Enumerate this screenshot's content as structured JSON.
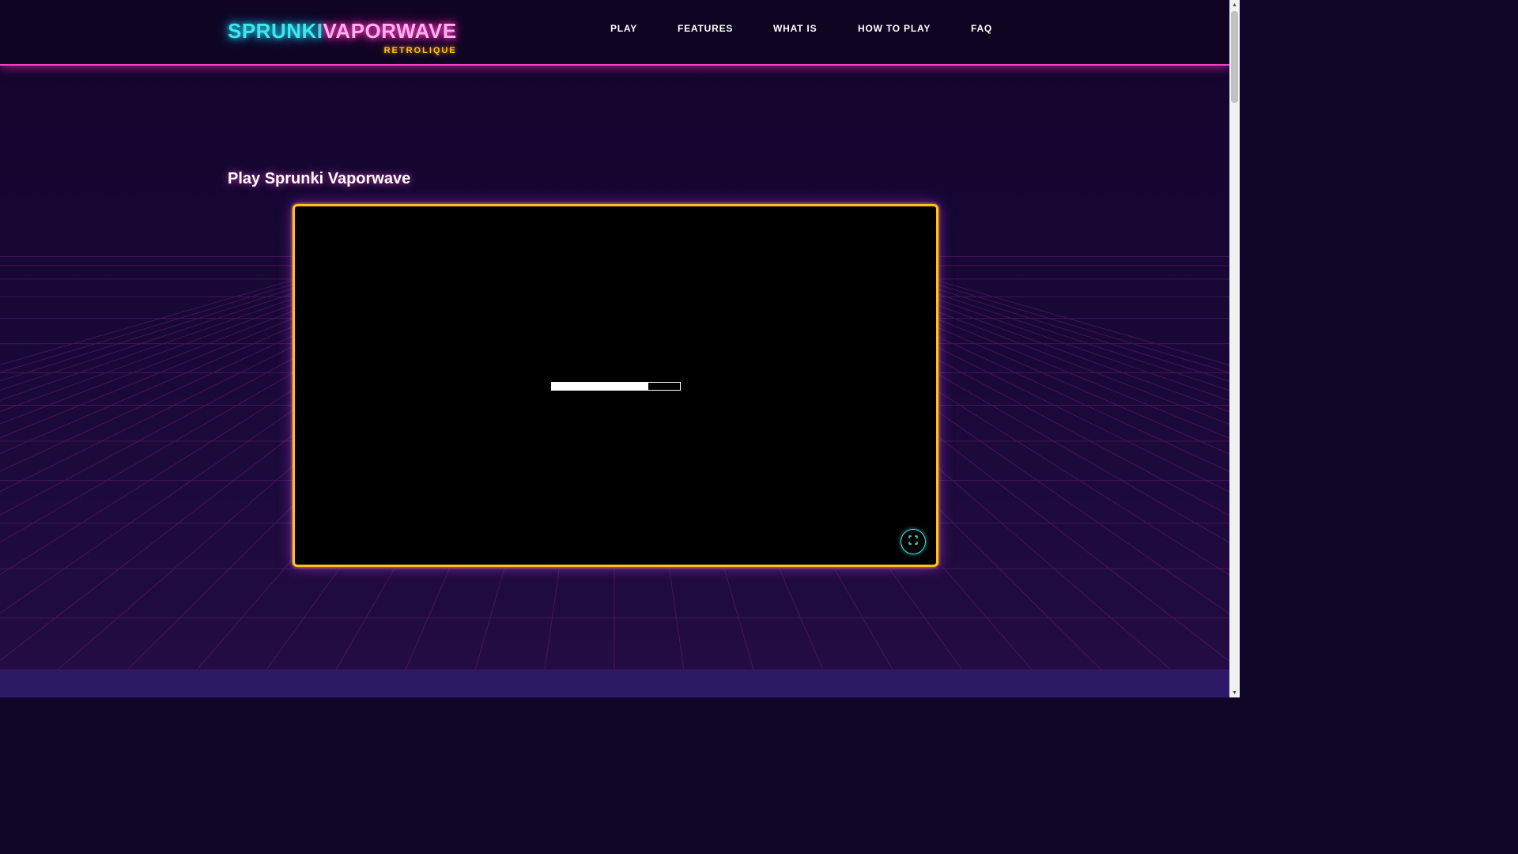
{
  "header": {
    "logo_part1": "SPRUNKI",
    "logo_part2": "VAPORWAVE",
    "logo_tagline": "RETROLIQUE",
    "nav": [
      {
        "label": "PLAY"
      },
      {
        "label": "FEATURES"
      },
      {
        "label": "WHAT IS"
      },
      {
        "label": "HOW TO PLAY"
      },
      {
        "label": "FAQ"
      }
    ]
  },
  "main": {
    "section_title": "Play Sprunki Vaporwave",
    "game": {
      "loading_progress": 0.75,
      "fullscreen_icon": "expand-icon"
    }
  },
  "colors": {
    "accent_cyan": "#3ee8e8",
    "accent_pink": "#ff3cc8",
    "accent_yellow": "#ffc21a",
    "background": "#120628",
    "bottom_bar": "#2d1a66"
  }
}
